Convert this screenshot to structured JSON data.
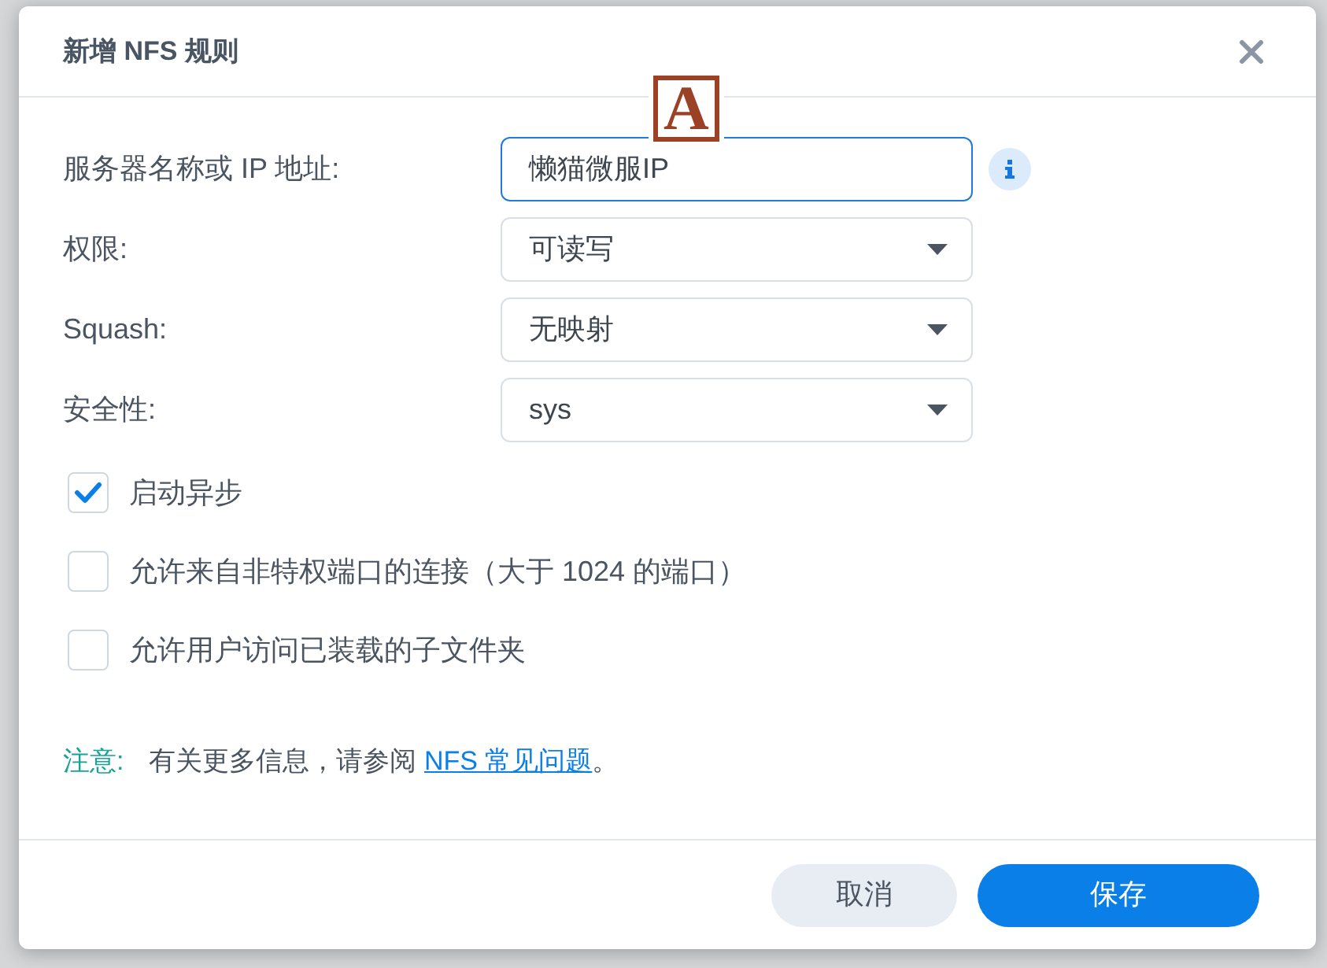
{
  "dialog": {
    "title": "新增 NFS 规则"
  },
  "annotation": {
    "label": "A"
  },
  "fields": [
    {
      "kind": "text",
      "label": "服务器名称或 IP 地址:",
      "value": "懒猫微服IP",
      "focused": true,
      "info": true
    },
    {
      "kind": "select",
      "label": "权限:",
      "value": "可读写",
      "focused": false,
      "info": false
    },
    {
      "kind": "select",
      "label": "Squash:",
      "value": "无映射",
      "focused": false,
      "info": false
    },
    {
      "kind": "select",
      "label": "安全性:",
      "value": "sys",
      "focused": false,
      "info": false
    }
  ],
  "checkboxes": [
    {
      "label": "启动异步",
      "checked": true
    },
    {
      "label": "允许来自非特权端口的连接（大于 1024 的端口）",
      "checked": false
    },
    {
      "label": "允许用户访问已装载的子文件夹",
      "checked": false
    }
  ],
  "note": {
    "label": "注意:",
    "text_before": "有关更多信息，请参阅",
    "link": "NFS 常见问题",
    "text_after": "。"
  },
  "buttons": [
    {
      "label": "取消",
      "kind": "secondary"
    },
    {
      "label": "保存",
      "kind": "primary"
    }
  ]
}
